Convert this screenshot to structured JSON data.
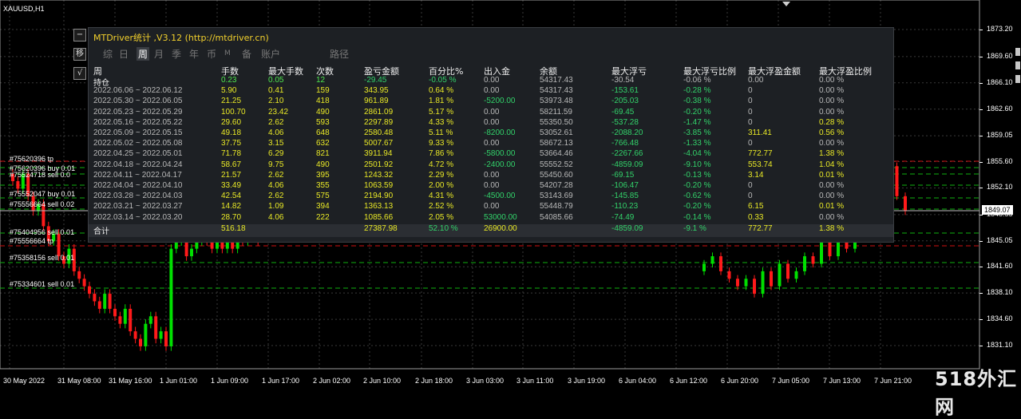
{
  "chart": {
    "symbol": "XAUUSD,H1",
    "current_price": "1849.07",
    "price_ticks": [
      "1873.20",
      "1869.60",
      "1866.10",
      "1862.60",
      "1859.05",
      "1855.60",
      "1852.10",
      "1848.55",
      "1845.05",
      "1841.60",
      "1838.10",
      "1834.60",
      "1831.10"
    ],
    "time_ticks": [
      "30 May 2022",
      "31 May 08:00",
      "31 May 16:00",
      "1 Jun 01:00",
      "1 Jun 09:00",
      "1 Jun 17:00",
      "2 Jun 02:00",
      "2 Jun 10:00",
      "2 Jun 18:00",
      "3 Jun 03:00",
      "3 Jun 11:00",
      "3 Jun 19:00",
      "6 Jun 04:00",
      "6 Jun 12:00",
      "6 Jun 20:00",
      "7 Jun 05:00",
      "7 Jun 13:00",
      "7 Jun 21:00"
    ],
    "order_labels": [
      "#75620396 buy 0.01",
      "#75524718 sell 0.0",
      "#75552047 buy 0.01",
      "#75556664 sell 0.02",
      "#75404956 sell 0.01",
      "#75358156 sell 0.01",
      "#75334601 sell 0.01"
    ],
    "tp_labels": [
      "#75620396 tp",
      "#75556664 tp"
    ],
    "watermark": "518外汇网",
    "colors": {
      "bull": "#00e000",
      "bear": "#ff1a1a",
      "grid": "#3a3a3a",
      "sell_line": "#00b400",
      "tp_line": "#e01010"
    }
  },
  "side_buttons": [
    "−",
    "移",
    "√"
  ],
  "panel": {
    "title": "MTDriver统计 ,V3.12 (http://mtdriver.cn)",
    "tabs": [
      "综",
      "日",
      "周",
      "月",
      "季",
      "年",
      "币",
      "M",
      "备",
      "账户",
      "路径"
    ],
    "active_tab": "周",
    "headers": [
      "周",
      "手数",
      "最大手数",
      "次数",
      "盈亏金额",
      "百分比%",
      "出入金",
      "余额",
      "最大浮亏",
      "最大浮亏比例",
      "最大浮盈金额",
      "最大浮盈比例"
    ],
    "rows": [
      [
        "持仓",
        "0.23",
        "0.05",
        "12",
        "-29.45",
        "-0.05 %",
        "0.00",
        "54317.43",
        "-30.54",
        "-0.06 %",
        "0.00",
        "0.00 %"
      ],
      [
        "2022.06.06 ~ 2022.06.12",
        "5.90",
        "0.41",
        "159",
        "343.95",
        "0.64 %",
        "0.00",
        "54317.43",
        "-153.61",
        "-0.28 %",
        "0",
        "0.00 %"
      ],
      [
        "2022.05.30 ~ 2022.06.05",
        "21.25",
        "2.10",
        "418",
        "961.89",
        "1.81 %",
        "-5200.00",
        "53973.48",
        "-205.03",
        "-0.38 %",
        "0",
        "0.00 %"
      ],
      [
        "2022.05.23 ~ 2022.05.29",
        "100.70",
        "23.42",
        "490",
        "2861.09",
        "5.17 %",
        "0.00",
        "58211.59",
        "-69.45",
        "-0.20 %",
        "0",
        "0.00 %"
      ],
      [
        "2022.05.16 ~ 2022.05.22",
        "29.60",
        "2.62",
        "593",
        "2297.89",
        "4.33 %",
        "0.00",
        "55350.50",
        "-537.28",
        "-1.47 %",
        "0",
        "0.28 %"
      ],
      [
        "2022.05.09 ~ 2022.05.15",
        "49.18",
        "4.06",
        "648",
        "2580.48",
        "5.11 %",
        "-8200.00",
        "53052.61",
        "-2088.20",
        "-3.85 %",
        "311.41",
        "0.56 %"
      ],
      [
        "2022.05.02 ~ 2022.05.08",
        "37.75",
        "3.15",
        "632",
        "5007.67",
        "9.33 %",
        "0.00",
        "58672.13",
        "-766.48",
        "-1.33 %",
        "0",
        "0.00 %"
      ],
      [
        "2022.04.25 ~ 2022.05.01",
        "71.78",
        "6.29",
        "821",
        "3911.94",
        "7.86 %",
        "-5800.00",
        "53664.46",
        "-2267.66",
        "-4.04 %",
        "772.77",
        "1.38 %"
      ],
      [
        "2022.04.18 ~ 2022.04.24",
        "58.67",
        "9.75",
        "490",
        "2501.92",
        "4.72 %",
        "-2400.00",
        "55552.52",
        "-4859.09",
        "-9.10 %",
        "553.74",
        "1.04 %"
      ],
      [
        "2022.04.11 ~ 2022.04.17",
        "21.57",
        "2.62",
        "395",
        "1243.32",
        "2.29 %",
        "0.00",
        "55450.60",
        "-69.15",
        "-0.13 %",
        "3.14",
        "0.01 %"
      ],
      [
        "2022.04.04 ~ 2022.04.10",
        "33.49",
        "4.06",
        "355",
        "1063.59",
        "2.00 %",
        "0.00",
        "54207.28",
        "-106.47",
        "-0.20 %",
        "0",
        "0.00 %"
      ],
      [
        "2022.03.28 ~ 2022.04.03",
        "42.54",
        "2.62",
        "575",
        "2194.90",
        "4.31 %",
        "-4500.00",
        "53143.69",
        "-145.85",
        "-0.62 %",
        "0",
        "0.00 %"
      ],
      [
        "2022.03.21 ~ 2022.03.27",
        "14.82",
        "1.09",
        "394",
        "1363.13",
        "2.52 %",
        "0.00",
        "55448.79",
        "-110.23",
        "-0.20 %",
        "6.15",
        "0.01 %"
      ],
      [
        "2022.03.14 ~ 2022.03.20",
        "28.70",
        "4.06",
        "222",
        "1085.66",
        "2.05 %",
        "53000.00",
        "54085.66",
        "-74.49",
        "-0.14 %",
        "0.33",
        "0.00 %"
      ]
    ],
    "total": [
      "合计",
      "516.18",
      "",
      "",
      "27387.98",
      "52.10 %",
      "26900.00",
      "",
      "-4859.09",
      "-9.1 %",
      "772.77",
      "1.38 %"
    ]
  }
}
